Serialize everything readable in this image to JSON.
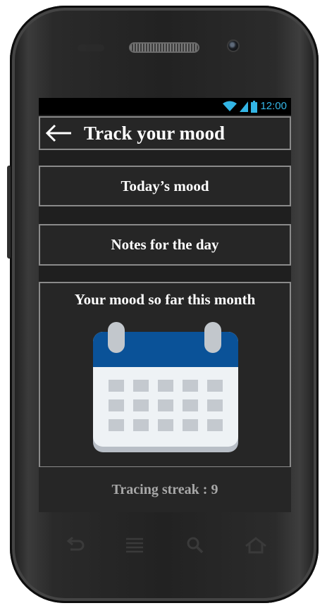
{
  "status_bar": {
    "time": "12:00",
    "icons": [
      "wifi-icon",
      "signal-icon",
      "battery-icon"
    ],
    "accent": "#33b5e5"
  },
  "header": {
    "title": "Track your mood",
    "back_icon": "arrow-left-icon"
  },
  "buttons": {
    "todays_mood": "Today’s mood",
    "notes": "Notes for the day"
  },
  "calendar_card": {
    "title": "Your mood so far this month",
    "icon": "calendar-icon"
  },
  "streak": {
    "text": "Tracing streak : 9"
  },
  "nav_bar": {
    "icons": [
      "back-nav-icon",
      "menu-nav-icon",
      "search-nav-icon",
      "home-nav-icon"
    ]
  },
  "colors": {
    "panel_bg": "#262626",
    "panel_border": "#8a8a8a",
    "calendar_header": "#0a5298",
    "calendar_body": "#eef2f5"
  }
}
